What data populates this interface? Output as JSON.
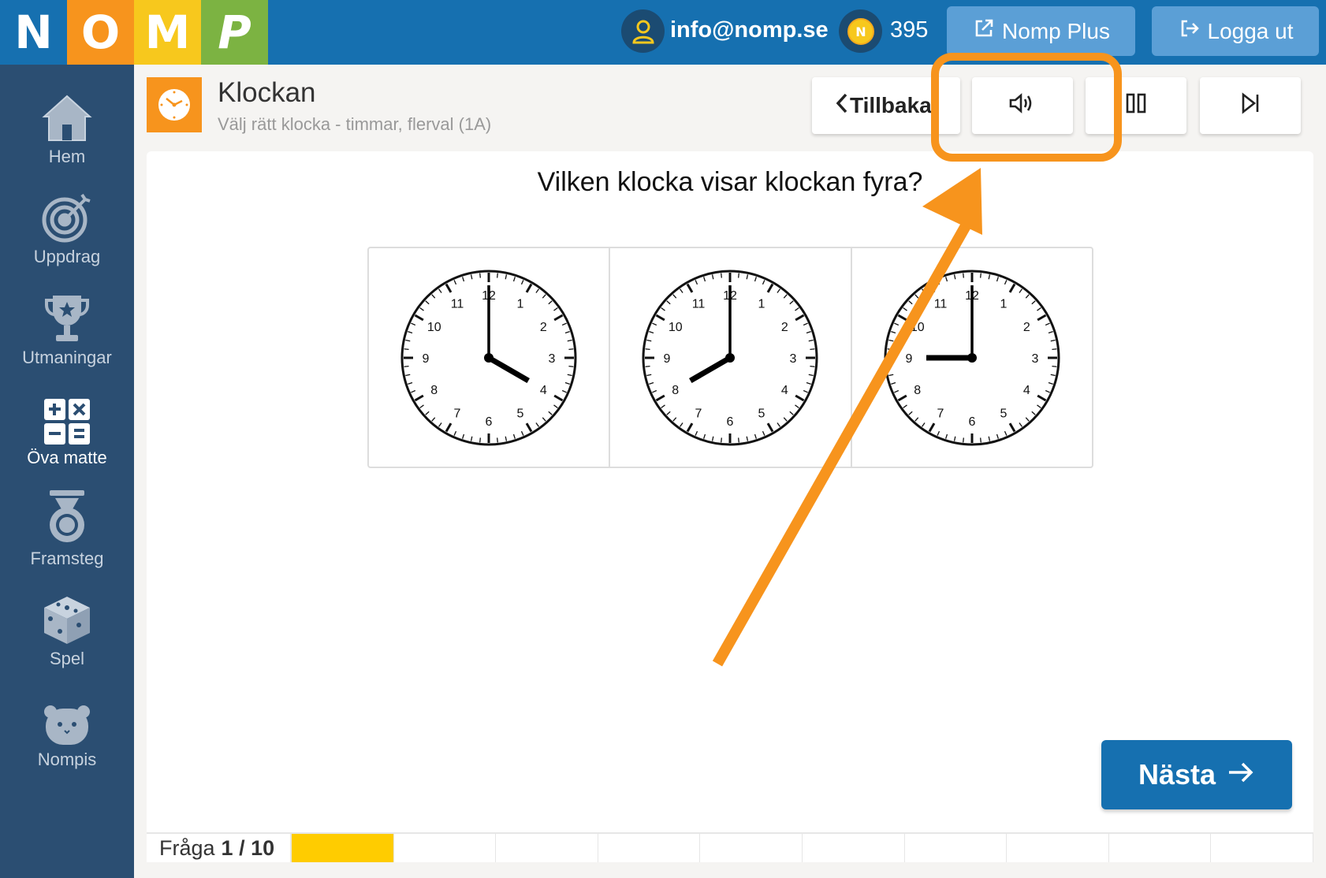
{
  "header": {
    "logo_letters": [
      "N",
      "O",
      "M",
      "P"
    ],
    "email": "info@nomp.se",
    "coins": "395",
    "plus_label": "Nomp Plus",
    "logout_label": "Logga ut"
  },
  "sidebar": {
    "items": [
      {
        "label": "Hem",
        "icon": "home-icon"
      },
      {
        "label": "Uppdrag",
        "icon": "target-icon"
      },
      {
        "label": "Utmaningar",
        "icon": "trophy-icon"
      },
      {
        "label": "Öva matte",
        "icon": "calculator-icon",
        "active": true
      },
      {
        "label": "Framsteg",
        "icon": "medal-icon"
      },
      {
        "label": "Spel",
        "icon": "dice-icon"
      },
      {
        "label": "Nompis",
        "icon": "bear-icon"
      }
    ]
  },
  "page": {
    "title": "Klockan",
    "subtitle": "Välj rätt klocka - timmar, flerval (1A)",
    "back_label": "Tillbaka"
  },
  "question": {
    "text": "Vilken klocka visar klockan fyra?",
    "choices": [
      {
        "hour": 4,
        "minute": 0
      },
      {
        "hour": 8,
        "minute": 0
      },
      {
        "hour": 9,
        "minute": 0
      }
    ]
  },
  "next_label": "Nästa",
  "progress": {
    "label": "Fråga",
    "value": "1 / 10",
    "current": 1,
    "total": 10
  },
  "colors": {
    "primary": "#1670b0",
    "sidebar": "#2b4e72",
    "accent_orange": "#f7941d",
    "progress_fill": "#ffcc00"
  }
}
